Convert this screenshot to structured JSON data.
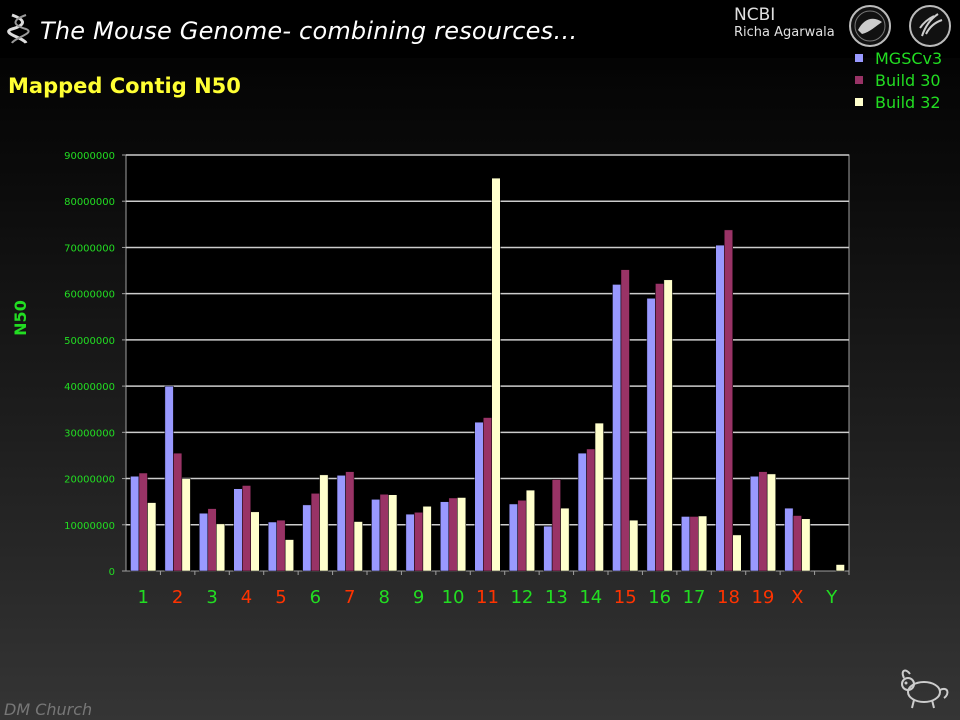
{
  "header": {
    "title": "The Mouse Genome- combining resources…",
    "org": "NCBI",
    "author": "Richa Agarwala"
  },
  "icons": [
    "dna-logo-icon",
    "hhs-seal-icon",
    "nih-seal-icon",
    "mouse-icon"
  ],
  "colors": {
    "background": "#000000",
    "title": "#ffffff",
    "subtitle": "#ffff33",
    "accent_green": "#22dd22",
    "accent_red": "#ff3300"
  },
  "footer": {
    "credit": "DM Church"
  },
  "chart_data": {
    "type": "bar",
    "title": "Mapped Contig N50",
    "xlabel": "",
    "ylabel": "N50",
    "ylim": [
      0,
      90000000
    ],
    "yticks": [
      0,
      10000000,
      20000000,
      30000000,
      40000000,
      50000000,
      60000000,
      70000000,
      80000000,
      90000000
    ],
    "ytick_labels": [
      "0",
      "10000000",
      "20000000",
      "30000000",
      "40000000",
      "50000000",
      "60000000",
      "70000000",
      "80000000",
      "90000000"
    ],
    "grid": true,
    "legend_position": "top-right",
    "categories": [
      "1",
      "2",
      "3",
      "4",
      "5",
      "6",
      "7",
      "8",
      "9",
      "10",
      "11",
      "12",
      "13",
      "14",
      "15",
      "16",
      "17",
      "18",
      "19",
      "X",
      "Y"
    ],
    "category_colors": [
      "#22dd22",
      "#ff3300",
      "#22dd22",
      "#ff3300",
      "#ff3300",
      "#22dd22",
      "#ff3300",
      "#22dd22",
      "#22dd22",
      "#22dd22",
      "#ff3300",
      "#22dd22",
      "#22dd22",
      "#22dd22",
      "#ff3300",
      "#22dd22",
      "#22dd22",
      "#ff3300",
      "#ff3300",
      "#ff3300",
      "#22dd22"
    ],
    "series": [
      {
        "name": "MGSCv3",
        "color": "#9999ff",
        "values": [
          20500000,
          40000000,
          12500000,
          17800000,
          10600000,
          14300000,
          20700000,
          15500000,
          12300000,
          15000000,
          32200000,
          14500000,
          9700000,
          25500000,
          62000000,
          59000000,
          11800000,
          70500000,
          20500000,
          13600000,
          0
        ]
      },
      {
        "name": "Build 30",
        "color": "#993366",
        "values": [
          21200000,
          25500000,
          13500000,
          18500000,
          11000000,
          16800000,
          21500000,
          16600000,
          12700000,
          15800000,
          33200000,
          15300000,
          19800000,
          26400000,
          65200000,
          62200000,
          11800000,
          73800000,
          21500000,
          12000000,
          0
        ]
      },
      {
        "name": "Build 32",
        "color": "#ffffcc",
        "values": [
          14800000,
          20000000,
          10200000,
          12800000,
          6800000,
          20800000,
          10700000,
          16500000,
          14000000,
          15900000,
          85000000,
          17500000,
          13600000,
          32000000,
          11000000,
          63000000,
          11900000,
          7800000,
          21000000,
          11300000,
          1400000
        ]
      }
    ]
  }
}
